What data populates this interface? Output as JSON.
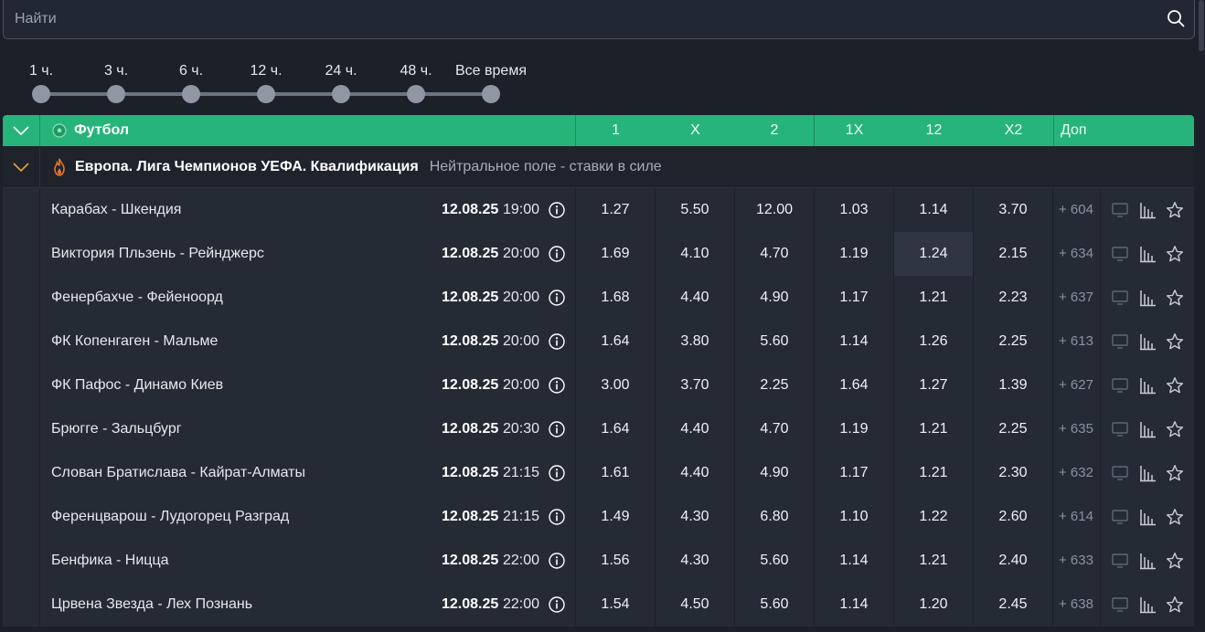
{
  "search": {
    "placeholder": "Найти"
  },
  "time_filter": {
    "options": [
      "1 ч.",
      "3 ч.",
      "6 ч.",
      "12 ч.",
      "24 ч.",
      "48 ч.",
      "Все время"
    ]
  },
  "table_header": {
    "sport": "Футбол",
    "columns": [
      "1",
      "X",
      "2",
      "1X",
      "12",
      "X2"
    ],
    "extra": "Доп"
  },
  "league": {
    "name": "Европа. Лига Чемпионов УЕФА. Квалификация",
    "note": "Нейтральное поле - ставки в силе"
  },
  "matches": [
    {
      "teams": "Карабах - Шкендия",
      "date": "12.08.25",
      "time": "19:00",
      "odds": [
        "1.27",
        "5.50",
        "12.00",
        "1.03",
        "1.14",
        "3.70"
      ],
      "more": "+ 604"
    },
    {
      "teams": "Виктория Пльзень - Рейнджерс",
      "date": "12.08.25",
      "time": "20:00",
      "odds": [
        "1.69",
        "4.10",
        "4.70",
        "1.19",
        "1.24",
        "2.15"
      ],
      "more": "+ 634"
    },
    {
      "teams": "Фенербахче - Фейеноорд",
      "date": "12.08.25",
      "time": "20:00",
      "odds": [
        "1.68",
        "4.40",
        "4.90",
        "1.17",
        "1.21",
        "2.23"
      ],
      "more": "+ 637"
    },
    {
      "teams": "ФК Копенгаген - Мальме",
      "date": "12.08.25",
      "time": "20:00",
      "odds": [
        "1.64",
        "3.80",
        "5.60",
        "1.14",
        "1.26",
        "2.25"
      ],
      "more": "+ 613"
    },
    {
      "teams": "ФК Пафос - Динамо Киев",
      "date": "12.08.25",
      "time": "20:00",
      "odds": [
        "3.00",
        "3.70",
        "2.25",
        "1.64",
        "1.27",
        "1.39"
      ],
      "more": "+ 627"
    },
    {
      "teams": "Брюгге - Зальцбург",
      "date": "12.08.25",
      "time": "20:30",
      "odds": [
        "1.64",
        "4.40",
        "4.70",
        "1.19",
        "1.21",
        "2.25"
      ],
      "more": "+ 635"
    },
    {
      "teams": "Слован Братислава - Кайрат-Алматы",
      "date": "12.08.25",
      "time": "21:15",
      "odds": [
        "1.61",
        "4.40",
        "4.90",
        "1.17",
        "1.21",
        "2.30"
      ],
      "more": "+ 632"
    },
    {
      "teams": "Ференцварош - Лудогорец Разград",
      "date": "12.08.25",
      "time": "21:15",
      "odds": [
        "1.49",
        "4.30",
        "6.80",
        "1.10",
        "1.22",
        "2.60"
      ],
      "more": "+ 614"
    },
    {
      "teams": "Бенфика - Ницца",
      "date": "12.08.25",
      "time": "22:00",
      "odds": [
        "1.56",
        "4.30",
        "5.60",
        "1.14",
        "1.21",
        "2.40"
      ],
      "more": "+ 633"
    },
    {
      "teams": "Црвена Звезда - Лех Познань",
      "date": "12.08.25",
      "time": "22:00",
      "odds": [
        "1.54",
        "4.50",
        "5.60",
        "1.14",
        "1.20",
        "2.45"
      ],
      "more": "+ 638"
    }
  ],
  "colors": {
    "accent": "#27b47a",
    "background": "#1b2029",
    "row": "#252b35",
    "league_icon": "#e8732a"
  },
  "icons": [
    "search-icon",
    "chevron-down-icon",
    "soccer-ball-icon",
    "fire-icon",
    "info-icon",
    "tv-icon",
    "stats-icon",
    "star-icon"
  ]
}
